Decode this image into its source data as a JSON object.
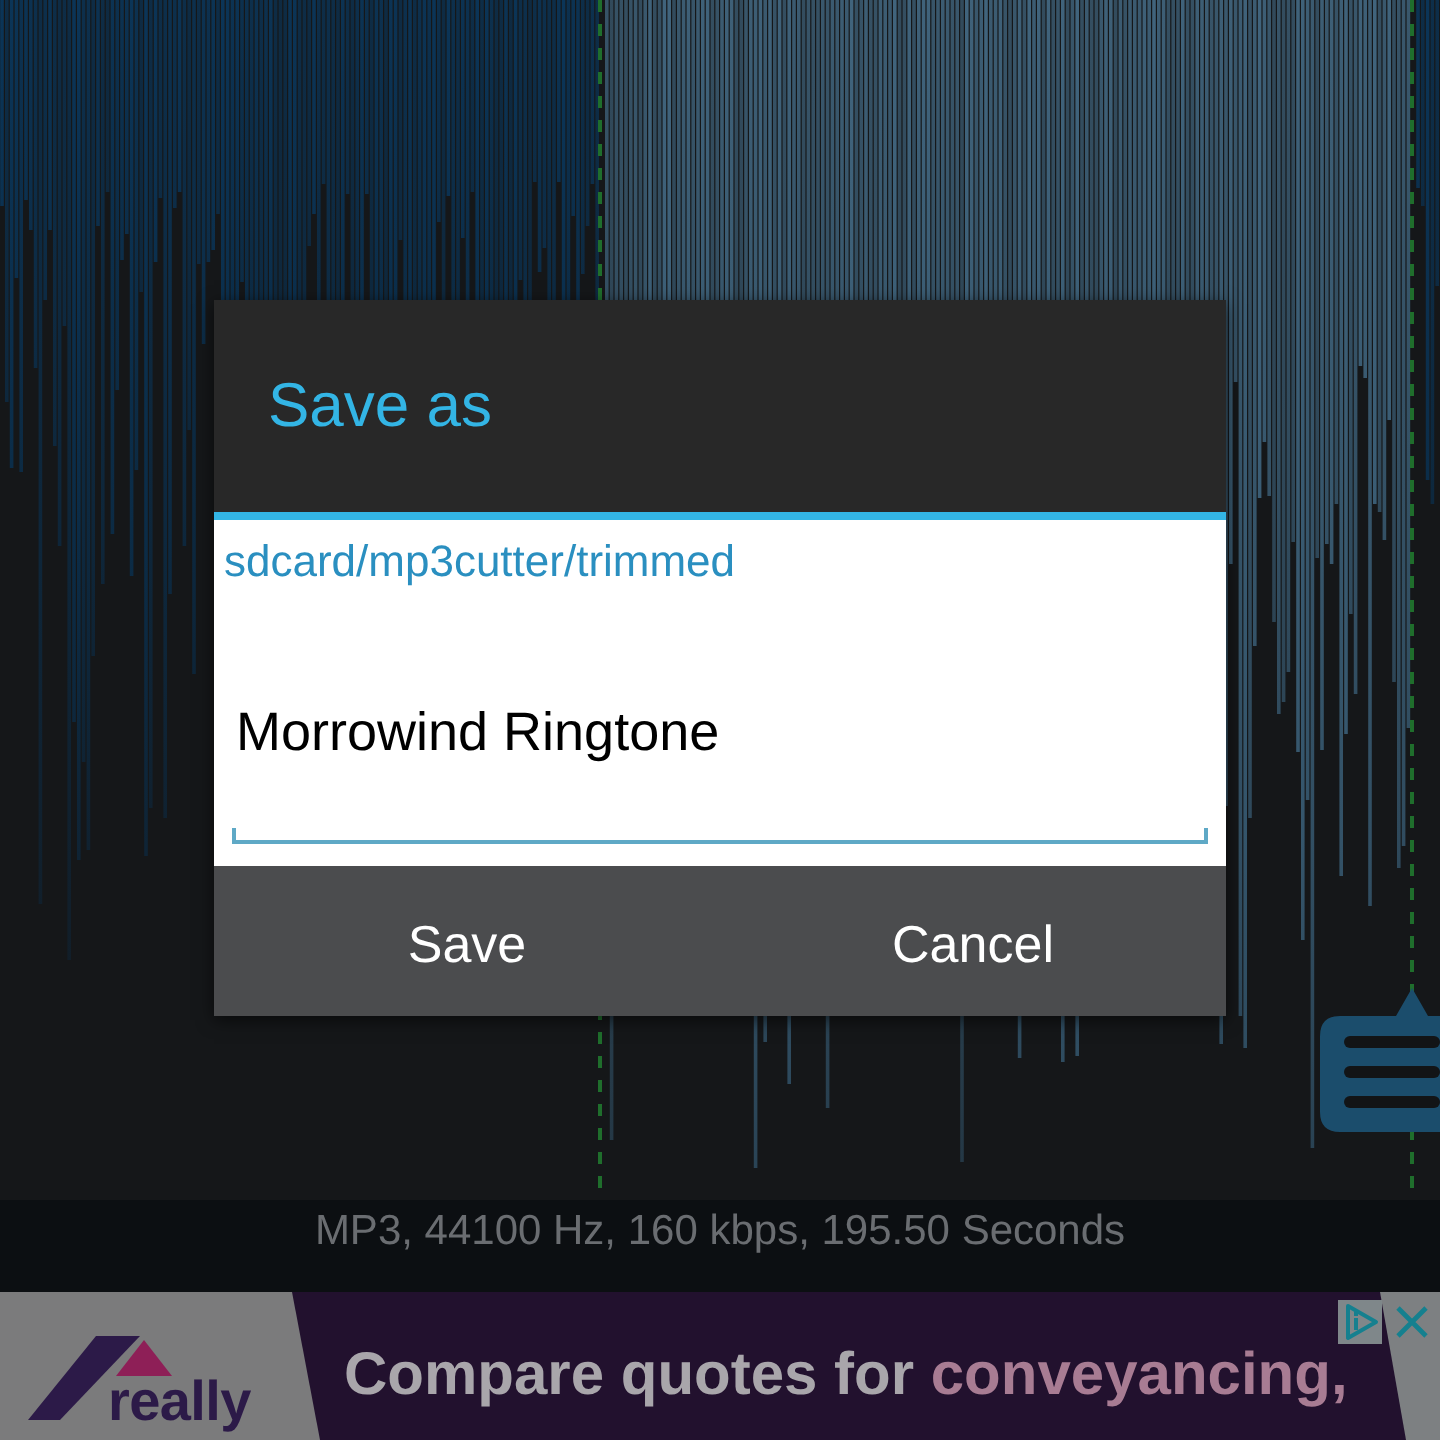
{
  "dialog": {
    "title": "Save as",
    "folder": "sdcard/mp3cutter/trimmed",
    "filename_field": {
      "value": "Morrowind Ringtone"
    },
    "buttons": [
      {
        "label": "Save"
      },
      {
        "label": "Cancel"
      }
    ]
  },
  "status_text": "MP3, 44100 Hz, 160 kbps, 195.50 Seconds",
  "ad": {
    "brand": "really",
    "headline": [
      {
        "text": "Compare quotes for",
        "highlight": false
      },
      {
        "text": "conveyancing,",
        "highlight": true
      }
    ]
  }
}
